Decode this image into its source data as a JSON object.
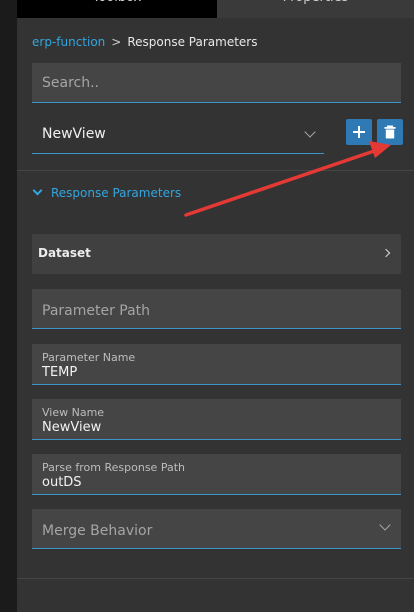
{
  "tabs": {
    "toolbox": "Toolbox",
    "properties": "Properties"
  },
  "breadcrumb": {
    "parent": "erp-function",
    "separator": ">",
    "current": "Response Parameters"
  },
  "search": {
    "placeholder": "Search.."
  },
  "view_select": {
    "value": "NewView"
  },
  "buttons": {
    "add_icon": "plus-icon",
    "delete_icon": "trash-icon"
  },
  "section": {
    "title": "Response Parameters"
  },
  "dataset": {
    "label": "Dataset"
  },
  "fields": {
    "parameter_path": {
      "placeholder": "Parameter Path"
    },
    "parameter_name": {
      "label": "Parameter Name",
      "value": "TEMP"
    },
    "view_name": {
      "label": "View Name",
      "value": "NewView"
    },
    "parse_path": {
      "label": "Parse from Response Path",
      "value": "outDS"
    },
    "merge_behavior": {
      "placeholder": "Merge Behavior"
    }
  },
  "colors": {
    "accent": "#33a6e0",
    "button": "#2f79b5",
    "annotation": "#e53935"
  }
}
